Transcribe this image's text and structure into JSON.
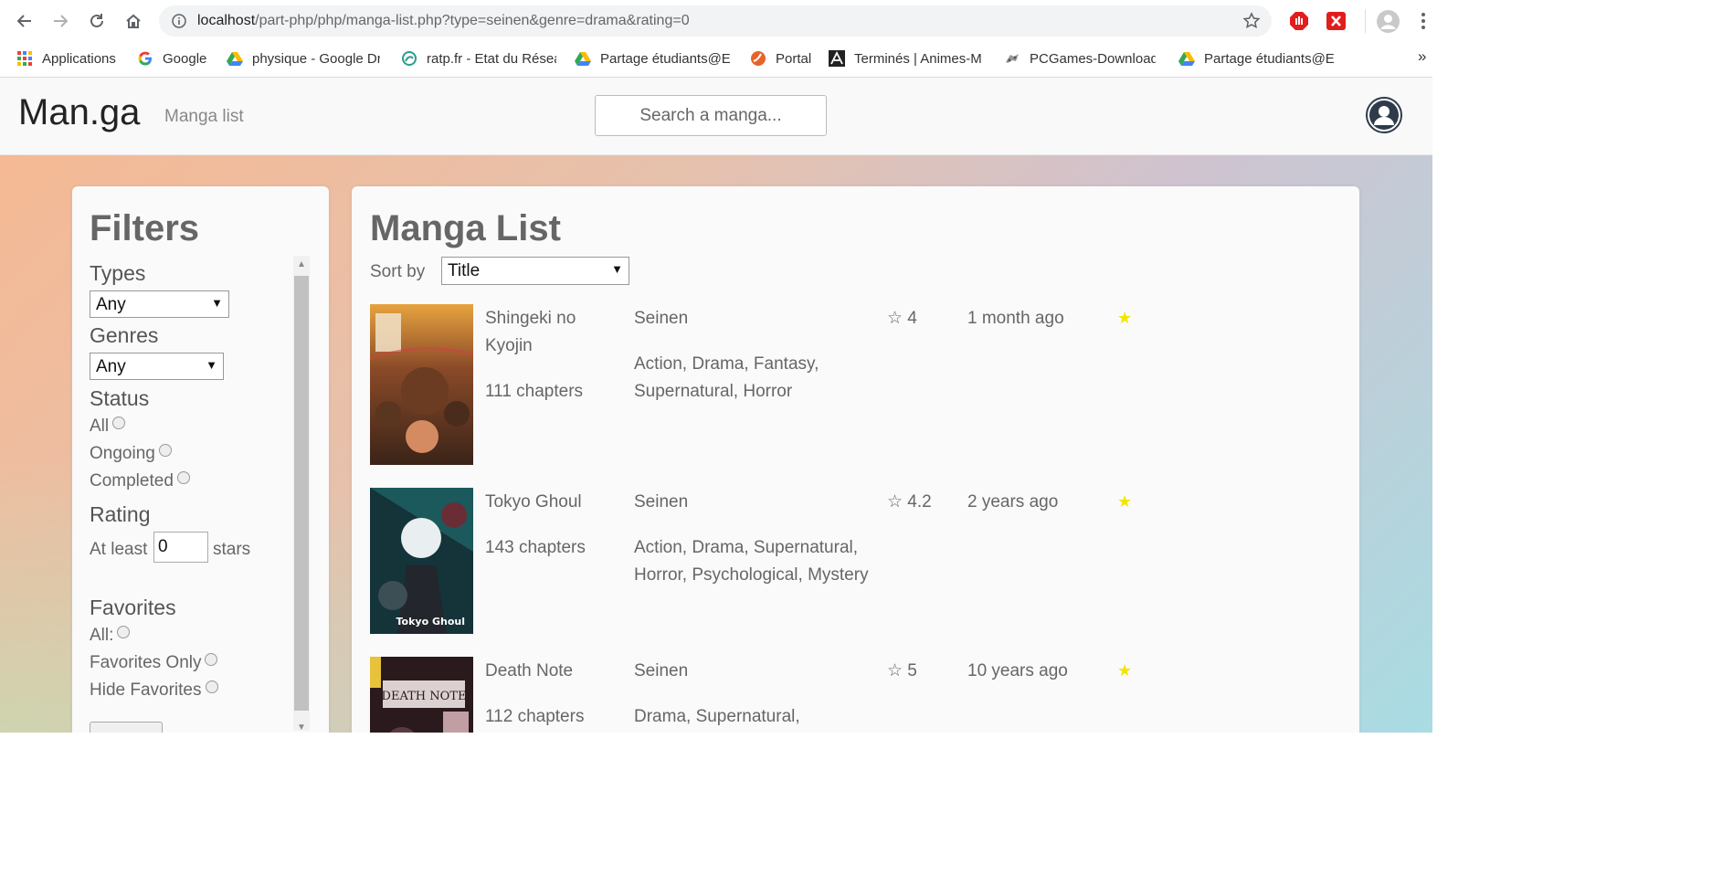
{
  "browser": {
    "url_host": "localhost",
    "url_path": "/part-php/php/manga-list.php?type=seinen&genre=drama&rating=0",
    "bookmarks": [
      {
        "label": "Applications",
        "icon": "apps-grid-icon"
      },
      {
        "label": "Google",
        "icon": "google-icon"
      },
      {
        "label": "physique - Google Dr",
        "icon": "drive-icon"
      },
      {
        "label": "ratp.fr - Etat du Résea",
        "icon": "ratp-icon"
      },
      {
        "label": "Partage étudiants@EF",
        "icon": "drive-icon"
      },
      {
        "label": "Portal",
        "icon": "portal-icon"
      },
      {
        "label": "Terminés | Animes-M",
        "icon": "animes-icon"
      },
      {
        "label": "PCGames-Download",
        "icon": "gamepad-icon"
      },
      {
        "label": "Partage étudiants@EF",
        "icon": "drive-icon"
      }
    ],
    "more_bookmarks": "»"
  },
  "navbar": {
    "brand": "Man.ga",
    "link": "Manga list",
    "search_placeholder": "Search a manga..."
  },
  "filters": {
    "title": "Filters",
    "types_label": "Types",
    "types_value": "Any",
    "genres_label": "Genres",
    "genres_value": "Any",
    "status_label": "Status",
    "status_options": [
      "All",
      "Ongoing",
      "Completed"
    ],
    "rating_label": "Rating",
    "rating_prefix": "At least",
    "rating_value": "0",
    "rating_suffix": "stars",
    "favorites_label": "Favorites",
    "favorites_options": [
      "All:",
      "Favorites Only",
      "Hide Favorites"
    ]
  },
  "list": {
    "title": "Manga List",
    "sort_label": "Sort by",
    "sort_value": "Title",
    "items": [
      {
        "title": "Shingeki no Kyojin",
        "chapters": "111 chapters",
        "type": "Seinen",
        "genres": "Action, Drama, Fantasy, Supernatural, Horror",
        "rating": "☆ 4",
        "updated": "1 month ago",
        "favorite": "★"
      },
      {
        "title": "Tokyo Ghoul",
        "chapters": "143 chapters",
        "type": "Seinen",
        "genres": "Action, Drama, Supernatural, Horror, Psychological, Mystery",
        "rating": "☆ 4.2",
        "updated": "2 years ago",
        "favorite": "★",
        "cover_caption": "Tokyo Ghoul"
      },
      {
        "title": "Death Note",
        "chapters": "112 chapters",
        "type": "Seinen",
        "genres": "Drama, Supernatural,",
        "rating": "☆ 5",
        "updated": "10 years ago",
        "favorite": "★",
        "cover_caption": "DEATH NOTE"
      }
    ]
  },
  "colors": {
    "favorite_star": "#f3e500",
    "gradient_start": "#f5b994",
    "gradient_end": "#a9dce3"
  }
}
